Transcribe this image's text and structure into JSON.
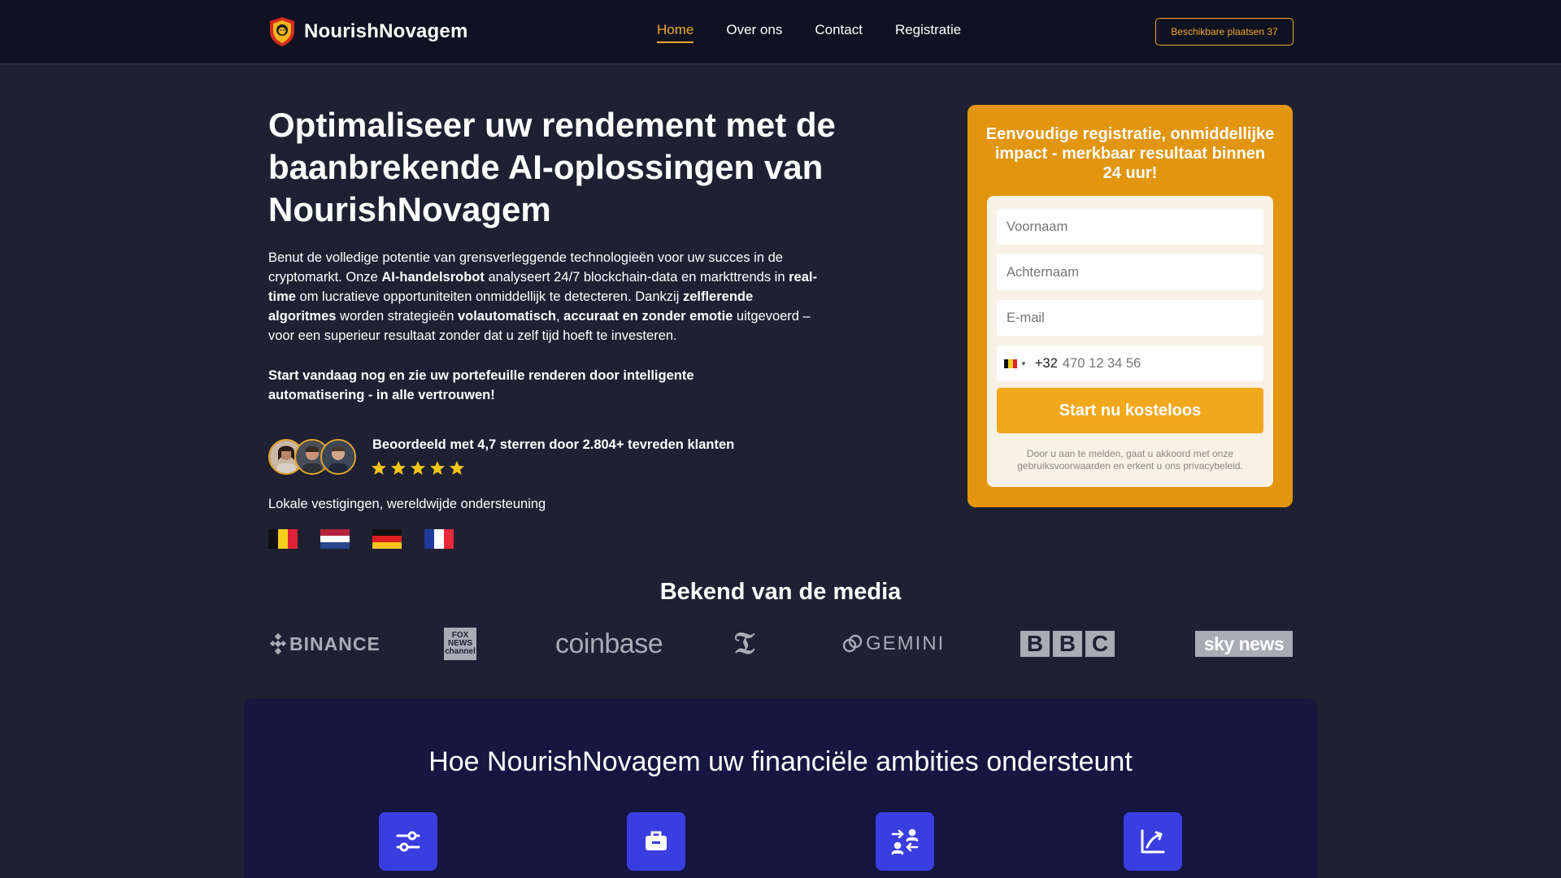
{
  "header": {
    "brand": "NourishNovagem",
    "nav": [
      {
        "label": "Home",
        "active": true
      },
      {
        "label": "Over ons",
        "active": false
      },
      {
        "label": "Contact",
        "active": false
      },
      {
        "label": "Registratie",
        "active": false
      }
    ],
    "seats_button": "Beschikbare plaatsen 37",
    "accent_color": "#f2a82a"
  },
  "hero": {
    "title": "Optimaliseer uw rendement met de baanbrekende AI-oplossingen van NourishNovagem",
    "paragraph": [
      {
        "text": "Benut de volledige potentie van grensverleggende technologieën voor uw succes in de cryptomarkt. Onze ",
        "bold": false
      },
      {
        "text": "AI-handelsrobot",
        "bold": true
      },
      {
        "text": " analyseert 24/7 blockchain-data en markttrends in ",
        "bold": false
      },
      {
        "text": "real-time",
        "bold": true
      },
      {
        "text": " om lucratieve opportuniteiten onmiddellijk te detecteren. Dankzij ",
        "bold": false
      },
      {
        "text": "zelflerende algoritmes",
        "bold": true
      },
      {
        "text": " worden strategieën ",
        "bold": false
      },
      {
        "text": "volautomatisch",
        "bold": true
      },
      {
        "text": ", ",
        "bold": false
      },
      {
        "text": "accuraat en zonder emotie",
        "bold": true
      },
      {
        "text": " uitgevoerd – voor een superieur resultaat zonder dat u zelf tijd hoeft te investeren.",
        "bold": false
      }
    ],
    "cta_text": "Start vandaag nog en zie uw portefeuille renderen door intelligente automatisering - in alle vertrouwen!",
    "rating_text": "Beoordeeld met 4,7 sterren door 2.804+ tevreden klanten",
    "stars": 5,
    "local_text": "Lokale vestigingen, wereldwijde ondersteuning",
    "flags": [
      "belgium-flag",
      "netherlands-flag",
      "germany-flag",
      "france-flag"
    ]
  },
  "form": {
    "title": "Eenvoudige registratie, onmiddellijke impact - merkbaar resultaat binnen 24 uur!",
    "first_name_placeholder": "Voornaam",
    "last_name_placeholder": "Achternaam",
    "email_placeholder": "E-mail",
    "phone_code": "+32",
    "phone_placeholder": "470 12 34 56",
    "submit_label": "Start nu kosteloos",
    "note": "Door u aan te melden, gaat u akkoord met onze gebruiksvoorwaarden en erkent u ons privacybeleid.",
    "card_color": "#e2960f",
    "button_color": "#f2a81d"
  },
  "media": {
    "title": "Bekend van de media",
    "logos": [
      "BINANCE",
      "FOX NEWS channel",
      "coinbase",
      "The New York Times",
      "GEMINI",
      "BBC",
      "sky news"
    ]
  },
  "features": {
    "title": "Hoe NourishNovagem uw financiële ambities ondersteunt",
    "icons": [
      "sliders-icon",
      "briefcase-icon",
      "user-exchange-icon",
      "chart-growth-icon"
    ],
    "icon_bg": "#3a3de0"
  }
}
